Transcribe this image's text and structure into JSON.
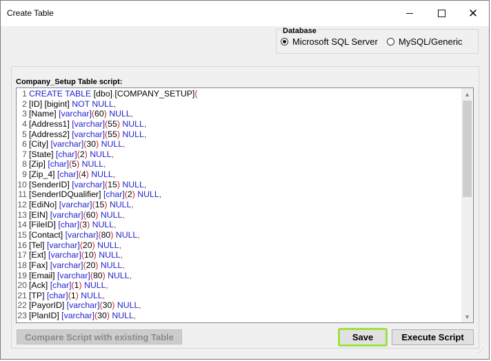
{
  "window": {
    "title": "Create Table",
    "minimize_label": "—",
    "close_label": "✕"
  },
  "database": {
    "group_label": "Database",
    "options": [
      {
        "label": "Microsoft SQL Server",
        "selected": true
      },
      {
        "label": "MySQL/Generic",
        "selected": false
      }
    ]
  },
  "script": {
    "label": "Company_Setup Table script:",
    "lines": [
      {
        "n": "1",
        "tokens": [
          [
            "kw",
            "CREATE TABLE "
          ],
          [
            "code",
            "[dbo]"
          ],
          [
            "br",
            "."
          ],
          [
            "code",
            "[COMPANY_SETUP]"
          ],
          [
            "br",
            "("
          ]
        ]
      },
      {
        "n": "2",
        "tokens": [
          [
            "code",
            "[ID] [bigint] "
          ],
          [
            "kw",
            "NOT NULL"
          ],
          [
            "br",
            ","
          ]
        ]
      },
      {
        "n": "3",
        "tokens": [
          [
            "code",
            "[Name] "
          ],
          [
            "ty",
            "[varchar]"
          ],
          [
            "br",
            "("
          ],
          [
            "code",
            "60"
          ],
          [
            "br",
            ")"
          ],
          [
            "kw",
            " NULL"
          ],
          [
            "br",
            ","
          ]
        ]
      },
      {
        "n": "4",
        "tokens": [
          [
            "code",
            "[Address1] "
          ],
          [
            "ty",
            "[varchar]"
          ],
          [
            "br",
            "("
          ],
          [
            "code",
            "55"
          ],
          [
            "br",
            ")"
          ],
          [
            "kw",
            " NULL"
          ],
          [
            "br",
            ","
          ]
        ]
      },
      {
        "n": "5",
        "tokens": [
          [
            "code",
            "[Address2] "
          ],
          [
            "ty",
            "[varchar]"
          ],
          [
            "br",
            "("
          ],
          [
            "code",
            "55"
          ],
          [
            "br",
            ")"
          ],
          [
            "kw",
            " NULL"
          ],
          [
            "br",
            ","
          ]
        ]
      },
      {
        "n": "6",
        "tokens": [
          [
            "code",
            "[City] "
          ],
          [
            "ty",
            "[varchar]"
          ],
          [
            "br",
            "("
          ],
          [
            "code",
            "30"
          ],
          [
            "br",
            ")"
          ],
          [
            "kw",
            " NULL"
          ],
          [
            "br",
            ","
          ]
        ]
      },
      {
        "n": "7",
        "tokens": [
          [
            "code",
            "[State] "
          ],
          [
            "ty",
            "[char]"
          ],
          [
            "br",
            "("
          ],
          [
            "code",
            "2"
          ],
          [
            "br",
            ")"
          ],
          [
            "kw",
            " NULL"
          ],
          [
            "br",
            ","
          ]
        ]
      },
      {
        "n": "8",
        "tokens": [
          [
            "code",
            "[Zip] "
          ],
          [
            "ty",
            "[char]"
          ],
          [
            "br",
            "("
          ],
          [
            "code",
            "5"
          ],
          [
            "br",
            ")"
          ],
          [
            "kw",
            " NULL"
          ],
          [
            "br",
            ","
          ]
        ]
      },
      {
        "n": "9",
        "tokens": [
          [
            "code",
            "[Zip_4] "
          ],
          [
            "ty",
            "[char]"
          ],
          [
            "br",
            "("
          ],
          [
            "code",
            "4"
          ],
          [
            "br",
            ")"
          ],
          [
            "kw",
            " NULL"
          ],
          [
            "br",
            ","
          ]
        ]
      },
      {
        "n": "10",
        "tokens": [
          [
            "code",
            "[SenderID] "
          ],
          [
            "ty",
            "[varchar]"
          ],
          [
            "br",
            "("
          ],
          [
            "code",
            "15"
          ],
          [
            "br",
            ")"
          ],
          [
            "kw",
            " NULL"
          ],
          [
            "br",
            ","
          ]
        ]
      },
      {
        "n": "11",
        "tokens": [
          [
            "code",
            "[SenderIDQualifier] "
          ],
          [
            "ty",
            "[char]"
          ],
          [
            "br",
            "("
          ],
          [
            "code",
            "2"
          ],
          [
            "br",
            ")"
          ],
          [
            "kw",
            " NULL"
          ],
          [
            "br",
            ","
          ]
        ]
      },
      {
        "n": "12",
        "tokens": [
          [
            "code",
            "[EdiNo] "
          ],
          [
            "ty",
            "[varchar]"
          ],
          [
            "br",
            "("
          ],
          [
            "code",
            "15"
          ],
          [
            "br",
            ")"
          ],
          [
            "kw",
            " NULL"
          ],
          [
            "br",
            ","
          ]
        ]
      },
      {
        "n": "13",
        "tokens": [
          [
            "code",
            "[EIN] "
          ],
          [
            "ty",
            "[varchar]"
          ],
          [
            "br",
            "("
          ],
          [
            "code",
            "60"
          ],
          [
            "br",
            ")"
          ],
          [
            "kw",
            " NULL"
          ],
          [
            "br",
            ","
          ]
        ]
      },
      {
        "n": "14",
        "tokens": [
          [
            "code",
            "[FileID] "
          ],
          [
            "ty",
            "[char]"
          ],
          [
            "br",
            "("
          ],
          [
            "code",
            "3"
          ],
          [
            "br",
            ")"
          ],
          [
            "kw",
            " NULL"
          ],
          [
            "br",
            ","
          ]
        ]
      },
      {
        "n": "15",
        "tokens": [
          [
            "code",
            "[Contact] "
          ],
          [
            "ty",
            "[varchar]"
          ],
          [
            "br",
            "("
          ],
          [
            "code",
            "80"
          ],
          [
            "br",
            ")"
          ],
          [
            "kw",
            " NULL"
          ],
          [
            "br",
            ","
          ]
        ]
      },
      {
        "n": "16",
        "tokens": [
          [
            "code",
            "[Tel] "
          ],
          [
            "ty",
            "[varchar]"
          ],
          [
            "br",
            "("
          ],
          [
            "code",
            "20"
          ],
          [
            "br",
            ")"
          ],
          [
            "kw",
            " NULL"
          ],
          [
            "br",
            ","
          ]
        ]
      },
      {
        "n": "17",
        "tokens": [
          [
            "code",
            "[Ext] "
          ],
          [
            "ty",
            "[varchar]"
          ],
          [
            "br",
            "("
          ],
          [
            "code",
            "10"
          ],
          [
            "br",
            ")"
          ],
          [
            "kw",
            " NULL"
          ],
          [
            "br",
            ","
          ]
        ]
      },
      {
        "n": "18",
        "tokens": [
          [
            "code",
            "[Fax] "
          ],
          [
            "ty",
            "[varchar]"
          ],
          [
            "br",
            "("
          ],
          [
            "code",
            "20"
          ],
          [
            "br",
            ")"
          ],
          [
            "kw",
            " NULL"
          ],
          [
            "br",
            ","
          ]
        ]
      },
      {
        "n": "19",
        "tokens": [
          [
            "code",
            "[Email] "
          ],
          [
            "ty",
            "[varchar]"
          ],
          [
            "br",
            "("
          ],
          [
            "code",
            "80"
          ],
          [
            "br",
            ")"
          ],
          [
            "kw",
            " NULL"
          ],
          [
            "br",
            ","
          ]
        ]
      },
      {
        "n": "20",
        "tokens": [
          [
            "code",
            "[Ack] "
          ],
          [
            "ty",
            "[char]"
          ],
          [
            "br",
            "("
          ],
          [
            "code",
            "1"
          ],
          [
            "br",
            ")"
          ],
          [
            "kw",
            " NULL"
          ],
          [
            "br",
            ","
          ]
        ]
      },
      {
        "n": "21",
        "tokens": [
          [
            "code",
            "[TP] "
          ],
          [
            "ty",
            "[char]"
          ],
          [
            "br",
            "("
          ],
          [
            "code",
            "1"
          ],
          [
            "br",
            ")"
          ],
          [
            "kw",
            " NULL"
          ],
          [
            "br",
            ","
          ]
        ]
      },
      {
        "n": "22",
        "tokens": [
          [
            "code",
            "[PayorID] "
          ],
          [
            "ty",
            "[varchar]"
          ],
          [
            "br",
            "("
          ],
          [
            "code",
            "30"
          ],
          [
            "br",
            ")"
          ],
          [
            "kw",
            " NULL"
          ],
          [
            "br",
            ","
          ]
        ]
      },
      {
        "n": "23",
        "tokens": [
          [
            "code",
            "[PlanID] "
          ],
          [
            "ty",
            "[varchar]"
          ],
          [
            "br",
            "("
          ],
          [
            "code",
            "30"
          ],
          [
            "br",
            ")"
          ],
          [
            "kw",
            " NULL"
          ],
          [
            "br",
            ","
          ]
        ]
      }
    ]
  },
  "buttons": {
    "compare": "Compare Script with existing Table",
    "save": "Save",
    "execute": "Execute Script"
  },
  "colors": {
    "keyword": "#2222cc",
    "bracket": "#cc2222",
    "save_highlight": "#9be23c"
  }
}
